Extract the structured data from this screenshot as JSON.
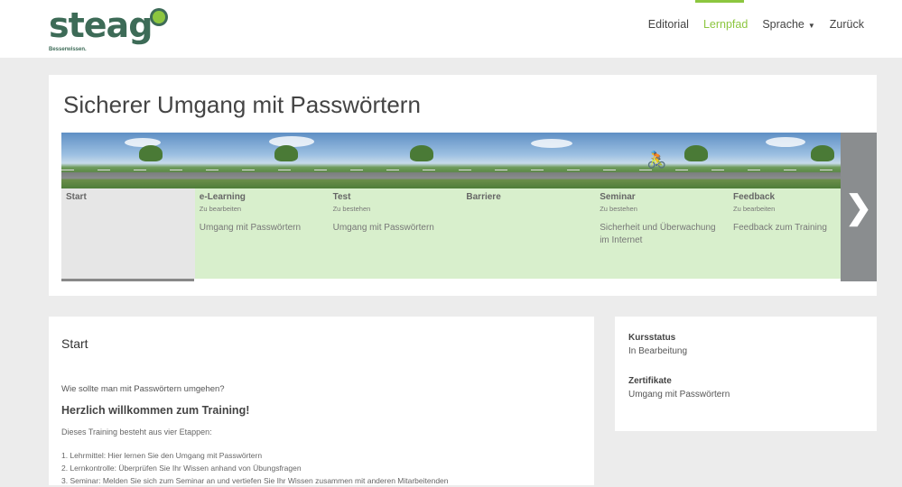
{
  "header": {
    "logo_text": "steag",
    "logo_tagline": "Besserwissen.",
    "nav": {
      "editorial": "Editorial",
      "lernpfad": "Lernpfad",
      "sprache": "Sprache",
      "zurueck": "Zurück"
    }
  },
  "course": {
    "title": "Sicherer Umgang mit Passwörtern",
    "steps": [
      {
        "title": "Start",
        "sub": "",
        "desc": ""
      },
      {
        "title": "e-Learning",
        "sub": "Zu bearbeiten",
        "desc": "Umgang mit Passwörtern"
      },
      {
        "title": "Test",
        "sub": "Zu bestehen",
        "desc": "Umgang mit Passwörtern"
      },
      {
        "title": "Barriere",
        "sub": "",
        "desc": ""
      },
      {
        "title": "Seminar",
        "sub": "Zu bestehen",
        "desc": "Sicherheit und Überwachung im Internet"
      },
      {
        "title": "Feedback",
        "sub": "Zu bearbeiten",
        "desc": "Feedback zum Training"
      }
    ]
  },
  "main": {
    "heading": "Start",
    "question": "Wie sollte man mit Passwörtern umgehen?",
    "welcome": "Herzlich willkommen zum Training!",
    "intro": "Dieses Training besteht aus vier Etappen:",
    "list": [
      "1. Lehrmittel: Hier lernen Sie den Umgang mit Passwörtern",
      "2. Lernkontrolle: Überprüfen Sie Ihr Wissen anhand von Übungsfragen",
      "3. Seminar: Melden Sie sich zum Seminar an und vertiefen Sie Ihr Wissen zusammen mit anderen Mitarbeitenden"
    ]
  },
  "side": {
    "status_label": "Kursstatus",
    "status_value": "In Bearbeitung",
    "cert_label": "Zertifikate",
    "cert_value": "Umgang mit Passwörtern"
  },
  "colors": {
    "accent": "#8cc63f",
    "brand": "#3d6b57",
    "step_green": "#d8efcc"
  }
}
